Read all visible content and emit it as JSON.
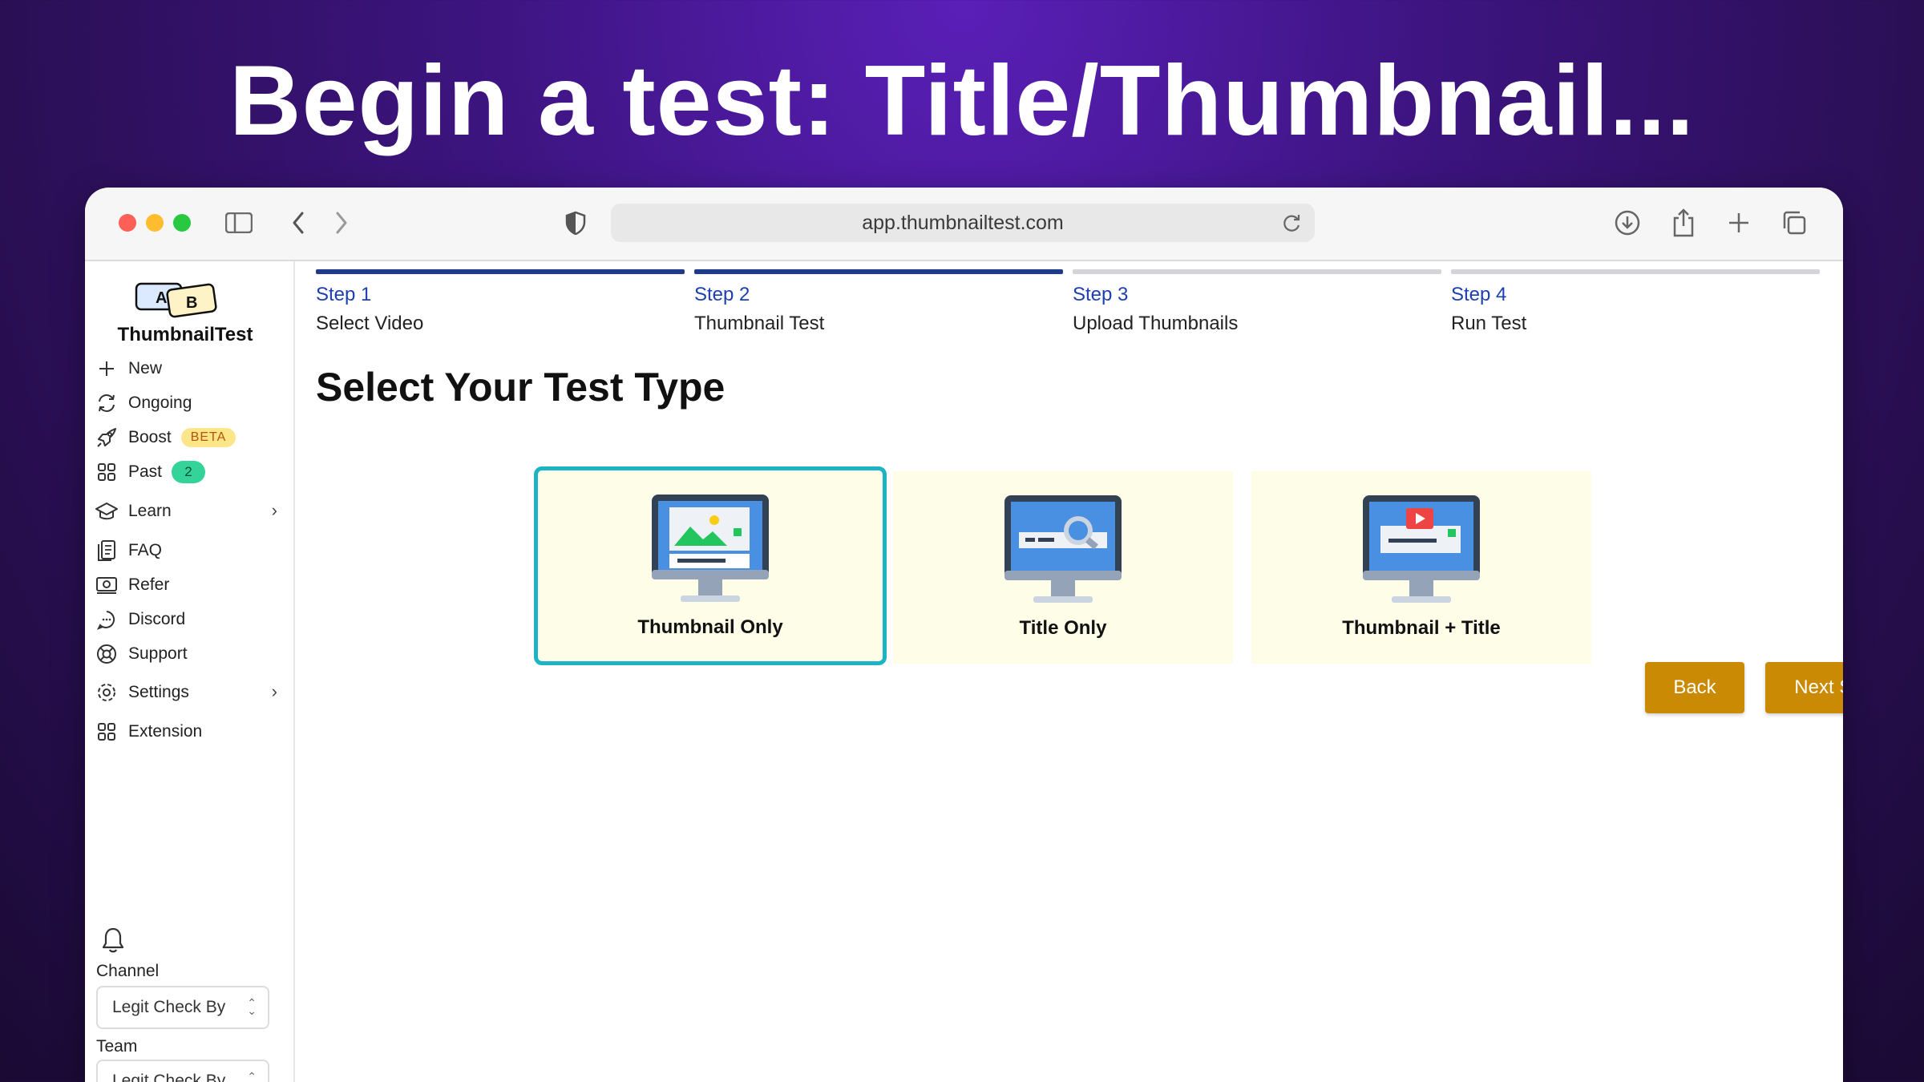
{
  "headline": "Begin a test: Title/Thumbnail...",
  "browser": {
    "url": "app.thumbnailtest.com"
  },
  "sidebar": {
    "brand": "ThumbnailTest",
    "logo_letters": [
      "A",
      "B"
    ],
    "items": [
      {
        "label": "New",
        "icon": "plus-icon"
      },
      {
        "label": "Ongoing",
        "icon": "refresh-icon"
      },
      {
        "label": "Boost",
        "icon": "rocket-icon",
        "badge": "BETA"
      },
      {
        "label": "Past",
        "icon": "grid-icon",
        "badge": "2"
      },
      {
        "label": "Learn",
        "icon": "graduation-cap-icon"
      },
      {
        "label": "FAQ",
        "icon": "document-icon"
      },
      {
        "label": "Refer",
        "icon": "money-icon"
      },
      {
        "label": "Discord",
        "icon": "chat-icon"
      },
      {
        "label": "Support",
        "icon": "lifebuoy-icon"
      },
      {
        "label": "Settings",
        "icon": "gear-icon"
      },
      {
        "label": "Extension",
        "icon": "grid-icon"
      }
    ],
    "channel_label": "Channel",
    "channel_value": "Legit Check By",
    "team_label": "Team",
    "team_value": "Legit Check By"
  },
  "steps": [
    {
      "num": "Step 1",
      "name": "Select Video",
      "active": true
    },
    {
      "num": "Step 2",
      "name": "Thumbnail Test",
      "active": true
    },
    {
      "num": "Step 3",
      "name": "Upload Thumbnails",
      "active": false
    },
    {
      "num": "Step 4",
      "name": "Run Test",
      "active": false
    }
  ],
  "page_title": "Select Your Test Type",
  "options": [
    {
      "label": "Thumbnail Only",
      "selected": true,
      "icon": "monitor-image-icon"
    },
    {
      "label": "Title Only",
      "selected": false,
      "icon": "monitor-search-icon"
    },
    {
      "label": "Thumbnail + Title",
      "selected": false,
      "icon": "monitor-video-icon"
    }
  ],
  "buttons": {
    "back": "Back",
    "next": "Next Step"
  },
  "colors": {
    "accent_button": "#ca8a04",
    "selected_border": "#1cb4c4",
    "step_active": "#1e3a8a",
    "card_bg": "#fdfde8"
  }
}
